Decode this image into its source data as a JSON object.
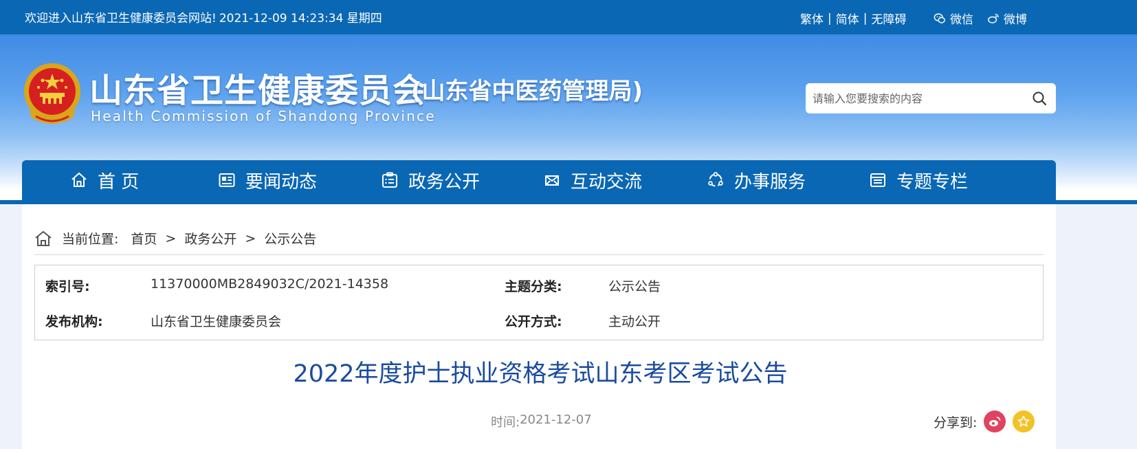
{
  "topbar": {
    "welcome": "欢迎进入山东省卫生健康委员会网站!",
    "datetime": "2021-12-09 14:23:34 星期四",
    "traditional": "繁体",
    "simplified": "简体",
    "accessible": "无障碍",
    "separator": "|",
    "wechat": "微信",
    "weibo": "微博"
  },
  "header": {
    "title": "山东省卫生健康委员会",
    "subtitle": "(山东省中医药管理局)",
    "english": "Health Commission of Shandong Province",
    "search_placeholder": "请输入您要搜索的内容"
  },
  "nav": {
    "items": [
      {
        "label": "首 页",
        "icon": "home-icon"
      },
      {
        "label": "要闻动态",
        "icon": "news-icon"
      },
      {
        "label": "政务公开",
        "icon": "clipboard-icon"
      },
      {
        "label": "互动交流",
        "icon": "exchange-icon"
      },
      {
        "label": "办事服务",
        "icon": "service-icon"
      },
      {
        "label": "专题专栏",
        "icon": "column-icon"
      }
    ]
  },
  "breadcrumb": {
    "prefix": "当前位置:",
    "items": [
      "首页",
      "政务公开",
      "公示公告"
    ],
    "separator": ">"
  },
  "meta": {
    "index_label": "索引号:",
    "index_value": "11370000MB2849032C/2021-14358",
    "topic_label": "主题分类:",
    "topic_value": "公示公告",
    "publisher_label": "发布机构:",
    "publisher_value": "山东省卫生健康委员会",
    "mode_label": "公开方式:",
    "mode_value": "主动公开"
  },
  "article": {
    "title": "2022年度护士执业资格考试山东考区考试公告",
    "date_label": "时间:",
    "date": "2021-12-07",
    "share_label": "分享到:"
  },
  "colors": {
    "primary": "#0a67b4",
    "title": "#1a4b9e",
    "weibo": "#e0435f",
    "favorite": "#f2c227"
  }
}
